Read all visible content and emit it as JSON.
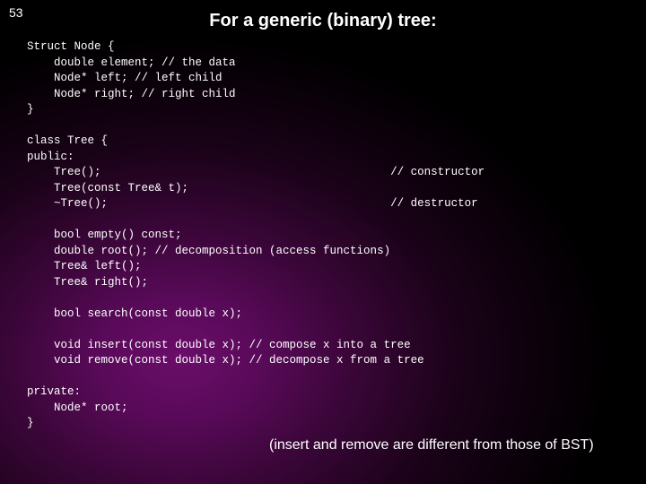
{
  "page_number": "53",
  "title": "For a generic (binary) tree:",
  "code": "Struct Node {\n    double element; // the data\n    Node* left; // left child\n    Node* right; // right child\n}\n\nclass Tree {\npublic:\n    Tree();                                           // constructor\n    Tree(const Tree& t);\n    ~Tree();                                          // destructor\n\n    bool empty() const;\n    double root(); // decomposition (access functions)\n    Tree& left();\n    Tree& right();\n\n    bool search(const double x);\n\n    void insert(const double x); // compose x into a tree\n    void remove(const double x); // decompose x from a tree\n\nprivate:\n    Node* root;\n}",
  "note": "(insert and remove are different from those of BST)"
}
